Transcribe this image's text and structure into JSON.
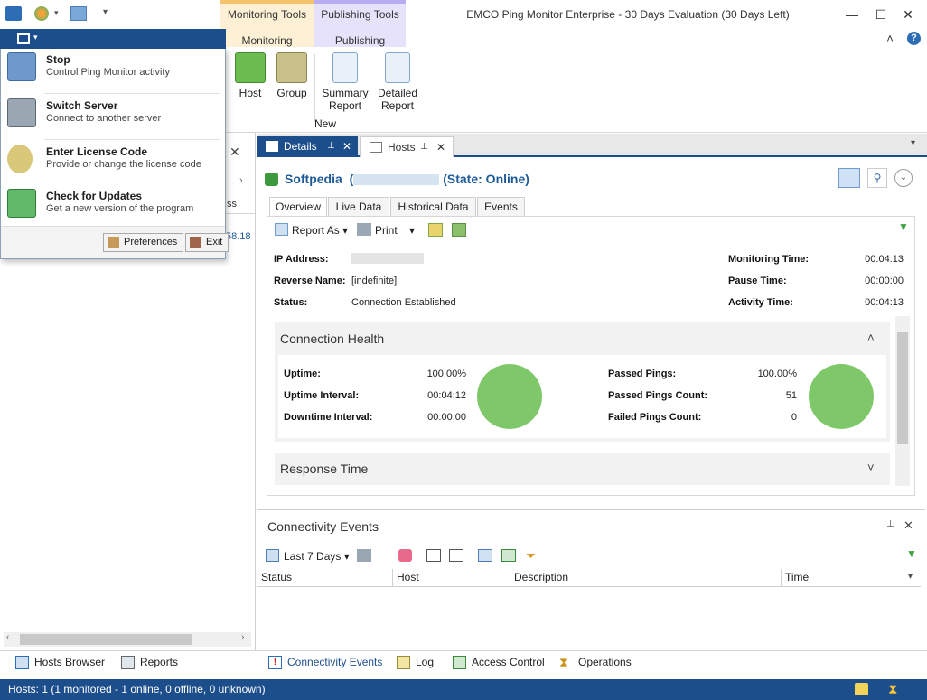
{
  "window": {
    "title": "EMCO Ping Monitor Enterprise - 30 Days Evaluation (30 Days Left)",
    "minimize": "—",
    "maximize": "☐",
    "close": "✕",
    "help": "?",
    "collapse": "˄"
  },
  "ribbon": {
    "context_tabs": [
      {
        "group": "Monitoring Tools",
        "tab": "Monitoring"
      },
      {
        "group": "Publishing Tools",
        "tab": "Publishing"
      }
    ],
    "buttons": {
      "host": "Host",
      "group": "Group",
      "summary_report": [
        "Summary",
        "Report"
      ],
      "detailed_report": [
        "Detailed",
        "Report"
      ]
    },
    "group_label": "New"
  },
  "app_menu": {
    "items": [
      {
        "title": "Stop",
        "desc": "Control Ping Monitor activity"
      },
      {
        "title": "Switch Server",
        "desc": "Connect to another server"
      },
      {
        "title": "Enter License Code",
        "desc": "Provide or change the license code"
      },
      {
        "title": "Check for Updates",
        "desc": "Get a new version of the program"
      }
    ],
    "preferences": "Preferences",
    "exit": "Exit"
  },
  "left_pane": {
    "partial_header": "ss",
    "partial_cell": "58.18"
  },
  "doc_tabs": {
    "details": "Details",
    "hosts": "Hosts"
  },
  "details": {
    "host_name": "Softpedia",
    "state_text": "(State: Online)",
    "paren_open": "(",
    "tabs": [
      "Overview",
      "Live Data",
      "Historical Data",
      "Events"
    ],
    "toolbar": {
      "report_as": "Report As",
      "print": "Print"
    },
    "info_left": [
      {
        "label": "IP Address:",
        "value": ""
      },
      {
        "label": "Reverse Name:",
        "value": "[indefinite]"
      },
      {
        "label": "Status:",
        "value": "Connection Established"
      }
    ],
    "info_right": [
      {
        "label": "Monitoring Time:",
        "value": "00:04:13"
      },
      {
        "label": "Pause Time:",
        "value": "00:00:00"
      },
      {
        "label": "Activity Time:",
        "value": "00:04:13"
      }
    ],
    "connection_health": {
      "header": "Connection Health",
      "left": [
        {
          "label": "Uptime:",
          "value": "100.00%"
        },
        {
          "label": "Uptime Interval:",
          "value": "00:04:12"
        },
        {
          "label": "Downtime Interval:",
          "value": "00:00:00"
        }
      ],
      "right": [
        {
          "label": "Passed Pings:",
          "value": "100.00%"
        },
        {
          "label": "Passed Pings Count:",
          "value": "51"
        },
        {
          "label": "Failed Pings Count:",
          "value": "0"
        }
      ]
    },
    "response_time_header": "Response Time"
  },
  "events": {
    "header": "Connectivity Events",
    "filter": "Last 7 Days",
    "columns": [
      "Status",
      "Host",
      "Description",
      "Time"
    ]
  },
  "bottom_tabs_left": [
    "Hosts Browser",
    "Reports"
  ],
  "bottom_tabs_right": [
    "Connectivity Events",
    "Log",
    "Access Control",
    "Operations"
  ],
  "status_bar": "Hosts: 1 (1 monitored - 1 online, 0 offline, 0 unknown)",
  "colors": {
    "accent": "#1d4e8c",
    "health_green": "#7fc86a",
    "title_blue": "#1d5a97"
  }
}
